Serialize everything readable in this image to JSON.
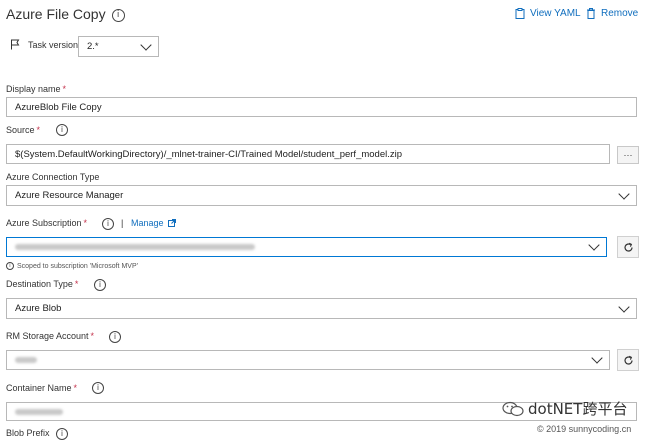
{
  "header": {
    "title": "Azure File Copy",
    "view_yaml": "View YAML",
    "remove": "Remove"
  },
  "task_version": {
    "label": "Task version",
    "value": "2.*"
  },
  "display_name": {
    "label": "Display name",
    "required": "*",
    "value": "AzureBlob File Copy"
  },
  "source": {
    "label": "Source",
    "required": "*",
    "value": "$(System.DefaultWorkingDirectory)/_mlnet-trainer-CI/Trained Model/student_perf_model.zip",
    "browse": "···"
  },
  "connection_type": {
    "label": "Azure Connection Type",
    "value": "Azure Resource Manager"
  },
  "subscription": {
    "label": "Azure Subscription",
    "required": "*",
    "separator": "|",
    "manage": "Manage",
    "scope_note": "Scoped to subscription 'Microsoft MVP'"
  },
  "destination_type": {
    "label": "Destination Type",
    "required": "*",
    "value": "Azure Blob"
  },
  "storage_account": {
    "label": "RM Storage Account",
    "required": "*"
  },
  "container_name": {
    "label": "Container Name",
    "required": "*"
  },
  "blob_prefix": {
    "label": "Blob Prefix"
  },
  "watermark": {
    "text": "dotNET跨平台",
    "copyright": "© 2019 sunnycoding.cn"
  }
}
